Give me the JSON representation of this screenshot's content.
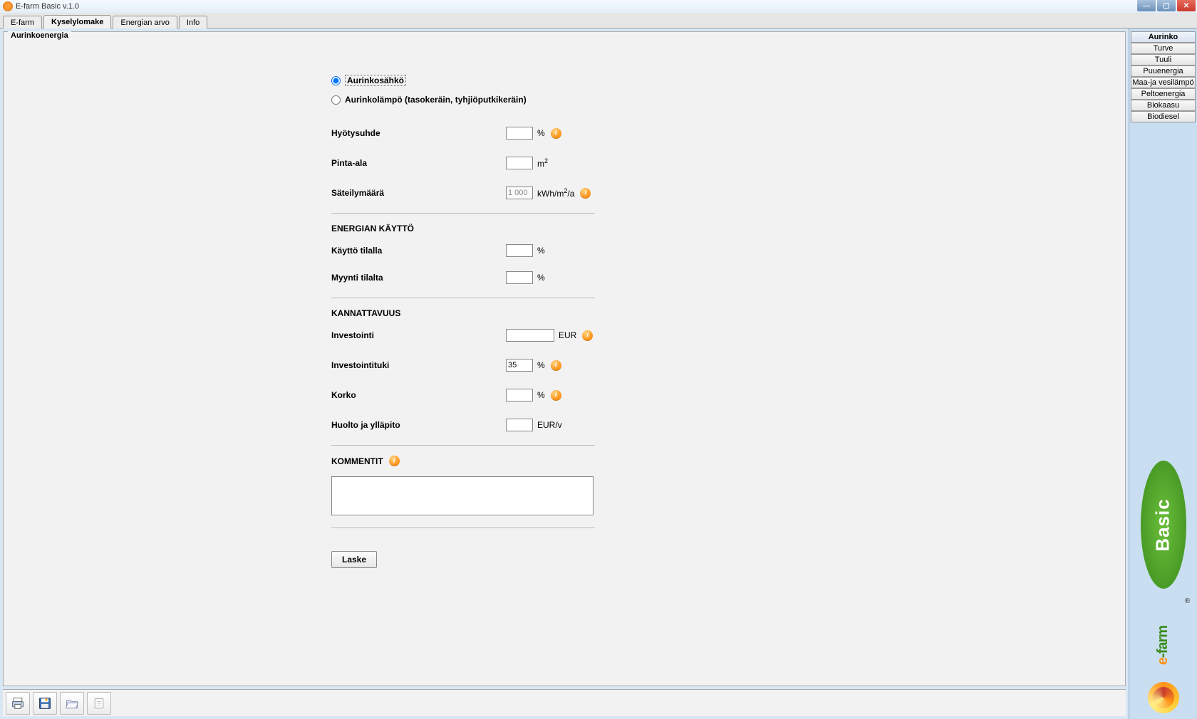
{
  "window": {
    "title": "E-farm Basic v.1.0"
  },
  "topTabs": {
    "items": [
      "E-farm",
      "Kyselylomake",
      "Energian arvo",
      "Info"
    ],
    "activeIndex": 1
  },
  "panel": {
    "title": "Aurinkoenergia"
  },
  "radios": {
    "opt1": "Aurinkosähkö",
    "opt2": "Aurinkolämpö (tasokeräin, tyhjiöputkikeräin)",
    "selected": 0
  },
  "fields": {
    "hyotysuhde": {
      "label": "Hyötysuhde",
      "value": "",
      "unit": "%"
    },
    "pinta_ala": {
      "label": "Pinta-ala",
      "value": "",
      "unit_html": "m²"
    },
    "sateily": {
      "label": "Säteilymäärä",
      "value": "1 000",
      "unit_html": "kWh/m²/a",
      "disabled": true
    }
  },
  "section_energian": "ENERGIAN KÄYTTÖ",
  "energian": {
    "kaytto": {
      "label": "Käyttö tilalla",
      "value": "",
      "unit": "%"
    },
    "myynti": {
      "label": "Myynti tilalta",
      "value": "",
      "unit": "%"
    }
  },
  "section_kannattavuus": "KANNATTAVUUS",
  "kannattavuus": {
    "investointi": {
      "label": "Investointi",
      "value": "",
      "unit": "EUR"
    },
    "investointituki": {
      "label": "Investointituki",
      "value": "35",
      "unit": "%"
    },
    "korko": {
      "label": "Korko",
      "value": "",
      "unit": "%"
    },
    "huolto": {
      "label": "Huolto ja ylläpito",
      "value": "",
      "unit": "EUR/v"
    }
  },
  "section_kommentit": "KOMMENTIT",
  "kommentit_value": "",
  "button_laske": "Laske",
  "sidebar": {
    "items": [
      "Aurinko",
      "Turve",
      "Tuuli",
      "Puuenergia",
      "Maa-ja vesilämpö",
      "Peltoenergia",
      "Biokaasu",
      "Biodiesel"
    ],
    "activeIndex": 0
  },
  "logo": {
    "basic": "Basic",
    "efarm": "-farm"
  },
  "icons": {
    "info_glyph": "i"
  }
}
